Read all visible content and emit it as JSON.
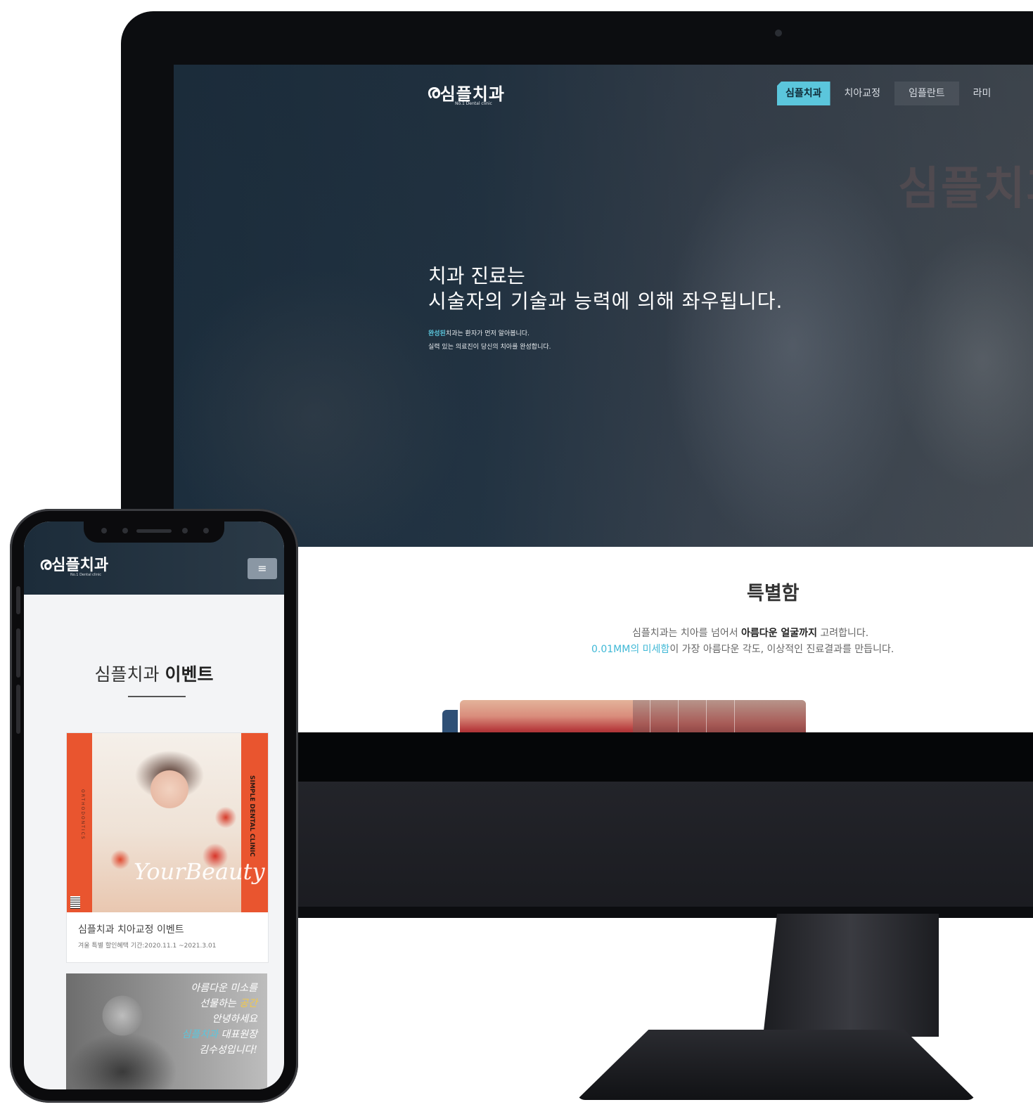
{
  "desktop": {
    "logo": {
      "mark": "ὠ",
      "name": "심플치과",
      "sub": "No.1 Dental clinic"
    },
    "nav": [
      "심플치과",
      "치아교정",
      "임플란트",
      "라미"
    ],
    "bg_sign": "심플치과",
    "hero": {
      "line1": "치과 진료는",
      "line2": "시술자의 기술과 능력에 의해 좌우됩니다.",
      "sub1_highlight": "완성된",
      "sub1_rest": "치과는 환자가 먼저 알아봅니다.",
      "sub2": "실력 있는 의료진이 당신의 치아를 완성합니다."
    },
    "feature": {
      "title": "특별함",
      "text1_a": "심플치과는 치아를 넘어서 ",
      "text1_bold": "아름다운 얼굴까지",
      "text1_b": " 고려합니다.",
      "text2_color": "0.01MM의 미세함",
      "text2_rest": "이 가장 아름다운 각도, 이상적인 진료결과를 만듭니다."
    }
  },
  "mobile": {
    "logo": {
      "name": "심플치과",
      "sub": "No.1 Dental clinic"
    },
    "menu_icon": "menu-icon",
    "section_title_a": "심플치과 ",
    "section_title_b": "이벤트",
    "card1": {
      "poster_script": "YourBeauty",
      "poster_side_right": "SIMPLE DENTAL CLINIC",
      "poster_side_left": "ORTHODONTICS",
      "title": "심플치과 치아교정 이벤트",
      "subtitle": "겨울 특별 할인혜택 기간:2020.11.1 ~2021.3.01"
    },
    "card2": {
      "hw1": "아름다운 미소를",
      "hw2a": "선물하는 ",
      "hw2b": "공간",
      "hw3": "안녕하세요",
      "hw4a": "심플치과 ",
      "hw4b": "대표원장",
      "hw5": "김수성입니다!"
    }
  },
  "colors": {
    "accent": "#5bc6dc",
    "hero_dark": "#1d3040",
    "poster_orange": "#e9552f"
  }
}
